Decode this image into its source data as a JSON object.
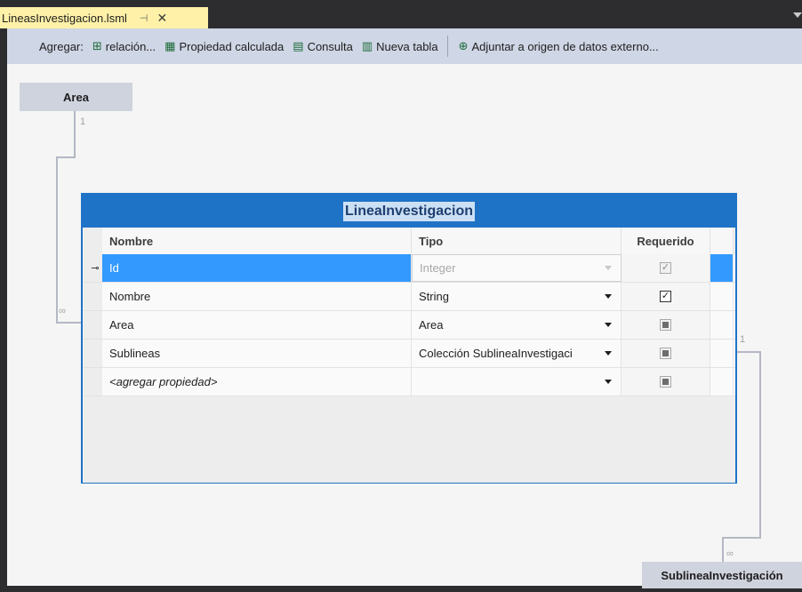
{
  "tab": {
    "title": "LineasInvestigacion.lsml",
    "pin_icon": "pin-icon",
    "close_glyph": "✕"
  },
  "toolbar": {
    "add_label": "Agregar:",
    "buttons": [
      {
        "label": "relación...",
        "icon": "relationship-icon"
      },
      {
        "label": "Propiedad calculada",
        "icon": "computed-property-icon"
      },
      {
        "label": "Consulta",
        "icon": "query-icon"
      },
      {
        "label": "Nueva tabla",
        "icon": "new-table-icon"
      },
      {
        "label": "Adjuntar a origen de datos externo...",
        "icon": "attach-datasource-icon"
      }
    ]
  },
  "canvas": {
    "area_entity": "Area",
    "area_cardinality": "1",
    "area_many": "∞",
    "sub_entity": "SublineaInvestigación",
    "sub_cardinality": "1",
    "sub_many": "∞"
  },
  "entity": {
    "title": "LineaInvestigacion",
    "columns": {
      "name": "Nombre",
      "type": "Tipo",
      "required": "Requerido"
    },
    "rows": [
      {
        "name": "Id",
        "type": "Integer",
        "required": "checked-disabled",
        "key": true,
        "selected": true
      },
      {
        "name": "Nombre",
        "type": "String",
        "required": "checked"
      },
      {
        "name": "Area",
        "type": "Area",
        "required": "indeterminate"
      },
      {
        "name": "Sublineas",
        "type": "Colección SublineaInvestigaci",
        "required": "indeterminate"
      }
    ],
    "new_row_placeholder": "<agregar propiedad>"
  },
  "colors": {
    "accent": "#1f73c6",
    "selection": "#3399ff",
    "tab_active": "#fff1a8",
    "toolbar": "#cfd6e5"
  }
}
